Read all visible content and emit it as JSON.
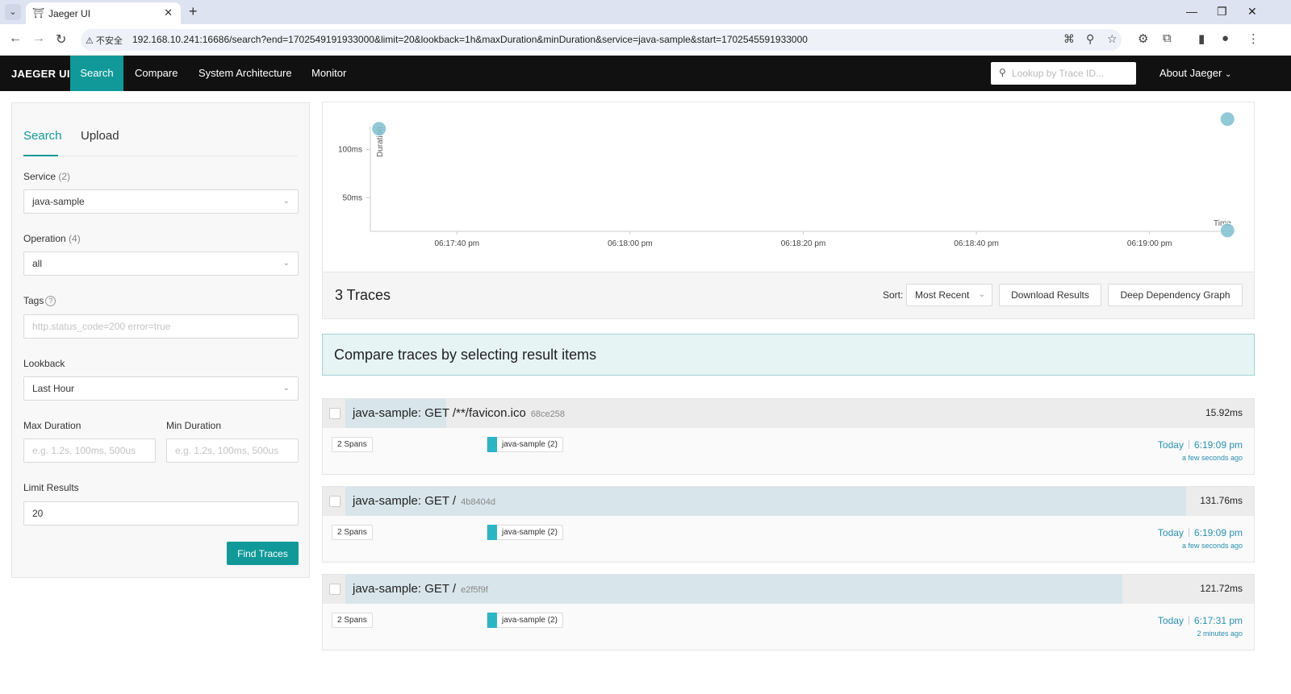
{
  "browser": {
    "tab_title": "Jaeger UI",
    "insecure_label": "不安全",
    "url": "192.168.10.241:16686/search?end=1702549191933000&limit=20&lookback=1h&maxDuration&minDuration&service=java-sample&start=1702545591933000"
  },
  "nav": {
    "brand": "JAEGER UI",
    "items": [
      "Search",
      "Compare",
      "System Architecture",
      "Monitor"
    ],
    "lookup_placeholder": "Lookup by Trace ID...",
    "about": "About Jaeger"
  },
  "search_panel": {
    "tabs": [
      "Search",
      "Upload"
    ],
    "service_label": "Service",
    "service_count": "(2)",
    "service_value": "java-sample",
    "operation_label": "Operation",
    "operation_count": "(4)",
    "operation_value": "all",
    "tags_label": "Tags",
    "tags_placeholder": "http.status_code=200 error=true",
    "lookback_label": "Lookback",
    "lookback_value": "Last Hour",
    "max_duration_label": "Max Duration",
    "max_duration_placeholder": "e.g. 1.2s, 100ms, 500us",
    "min_duration_label": "Min Duration",
    "min_duration_placeholder": "e.g. 1.2s, 100ms, 500us",
    "limit_label": "Limit Results",
    "limit_value": "20",
    "find_button": "Find Traces"
  },
  "chart_data": {
    "type": "scatter",
    "ylabel": "Duration",
    "xlabel": "Time",
    "y_ticks": [
      "50ms",
      "100ms"
    ],
    "y_tick_values": [
      50,
      100
    ],
    "x_ticks": [
      "06:17:40 pm",
      "06:18:00 pm",
      "06:18:20 pm",
      "06:18:40 pm",
      "06:19:00 pm"
    ],
    "x_tick_values": [
      1060,
      1080,
      1100,
      1120,
      1140
    ],
    "xlim": [
      1050,
      1150
    ],
    "ylim": [
      15,
      124
    ],
    "points": [
      {
        "x": 1051,
        "y": 121.72
      },
      {
        "x": 1149,
        "y": 131.76
      },
      {
        "x": 1149,
        "y": 15.92
      }
    ],
    "point_color": "#7fbfd0"
  },
  "results": {
    "title": "3 Traces",
    "sort_label": "Sort:",
    "sort_value": "Most Recent",
    "download_button": "Download Results",
    "ddg_button": "Deep Dependency Graph",
    "compare_text": "Compare traces by selecting result items"
  },
  "traces": [
    {
      "name": "java-sample: GET /**/favicon.ico",
      "id": "68ce258",
      "duration": "15.92ms",
      "bar_fraction": 0.12,
      "spans": "2 Spans",
      "service": "java-sample (2)",
      "day": "Today",
      "time": "6:19:09 pm",
      "ago": "a few seconds ago"
    },
    {
      "name": "java-sample: GET /",
      "id": "4b8404d",
      "duration": "131.76ms",
      "bar_fraction": 1.0,
      "spans": "2 Spans",
      "service": "java-sample (2)",
      "day": "Today",
      "time": "6:19:09 pm",
      "ago": "a few seconds ago"
    },
    {
      "name": "java-sample: GET /",
      "id": "e2f5f9f",
      "duration": "121.72ms",
      "bar_fraction": 0.924,
      "spans": "2 Spans",
      "service": "java-sample (2)",
      "day": "Today",
      "time": "6:17:31 pm",
      "ago": "2 minutes ago"
    }
  ]
}
